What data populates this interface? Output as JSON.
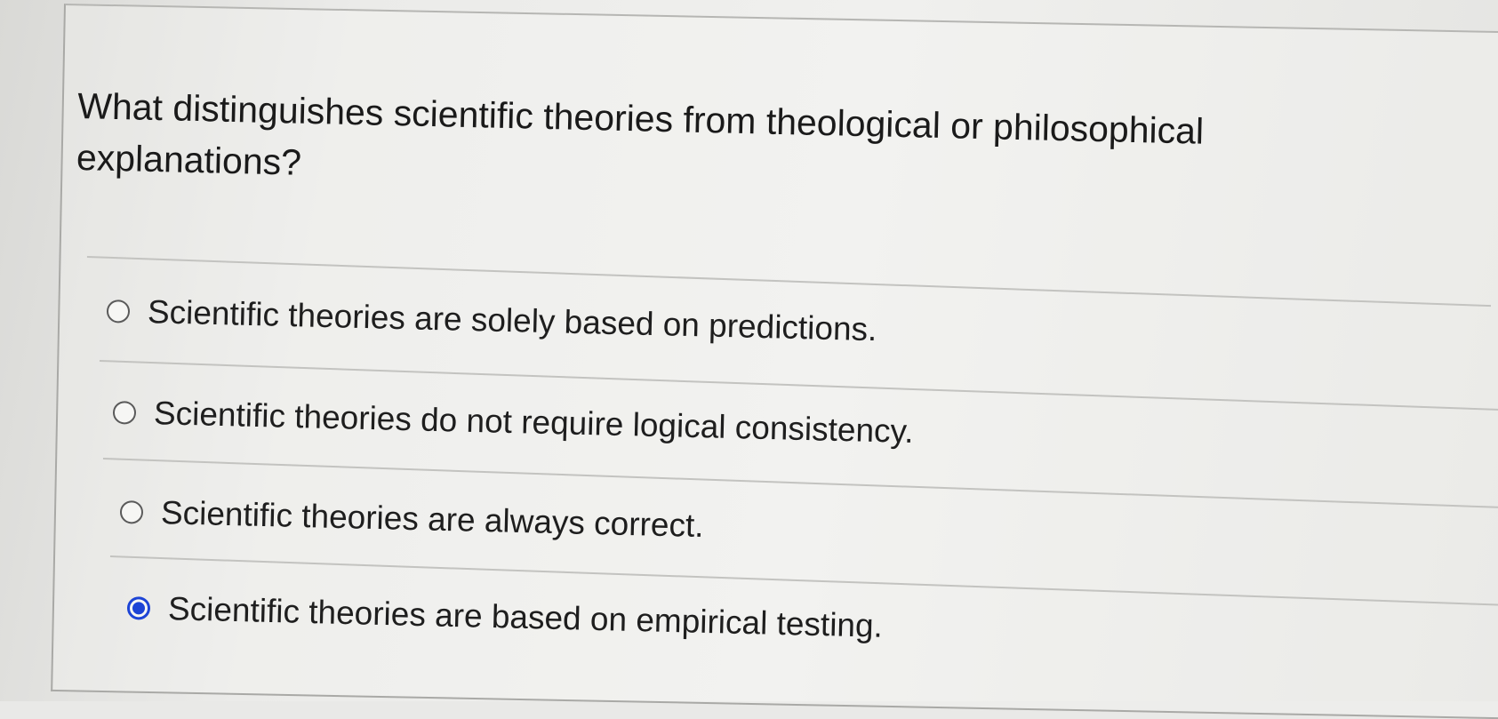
{
  "question": {
    "text": "What distinguishes scientific theories from theological or philosophical explanations?"
  },
  "answers": [
    {
      "label": "Scientific theories are solely based on predictions.",
      "selected": false
    },
    {
      "label": "Scientific theories do not require logical consistency.",
      "selected": false
    },
    {
      "label": "Scientific theories are always correct.",
      "selected": false
    },
    {
      "label": "Scientific theories are based on empirical testing.",
      "selected": true
    }
  ],
  "colors": {
    "selected_radio": "#1d44d6",
    "text": "#1e1e1e",
    "background": "#e9e9e7"
  }
}
